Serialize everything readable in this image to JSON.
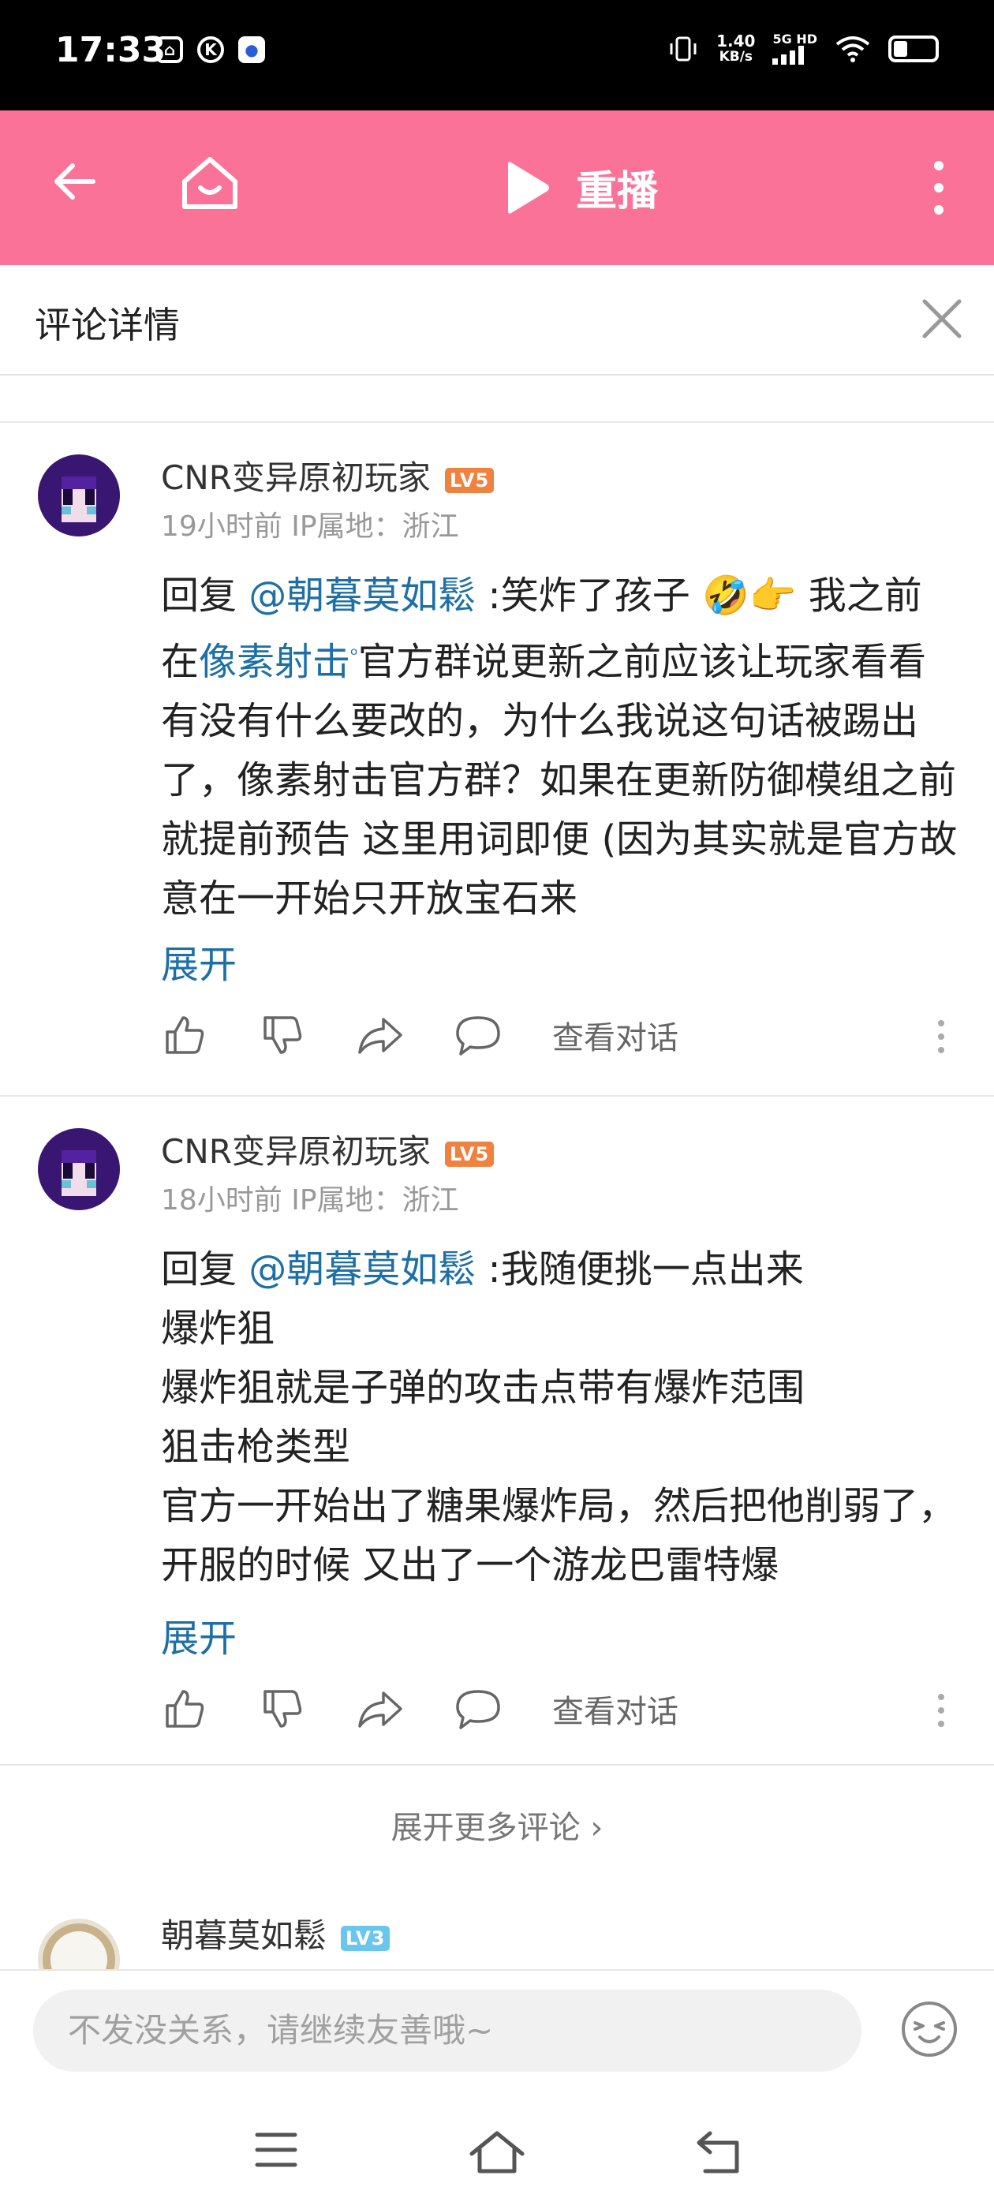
{
  "status_bar": {
    "time": "17:33",
    "left_icons": [
      "tv-icon",
      "k-icon",
      "paw-app-icon"
    ],
    "speed_value": "1.40",
    "speed_unit": "KB/s",
    "network": "5G HD"
  },
  "header": {
    "replay_label": "重播",
    "accent_color": "#fb7299"
  },
  "panel": {
    "title": "评论详情"
  },
  "comments": [
    {
      "username": "CNR变异原初玩家",
      "level": "LV5",
      "meta": "19小时前 IP属地：浙江",
      "reply_prefix": "回复 ",
      "mention": "@朝暮莫如鬆",
      "text_a": " :笑炸了孩子 🤣👉 我之前在",
      "link": "像素射击",
      "text_b": "官方群说更新之前应该让玩家看看有没有什么要改的，为什么我说这句话被踢出了，像素射击官方群？如果在更新防御模组之前就提前预告 这里用词即便 (因为其实就是官方故意在一开始只开放宝石来",
      "expand": "展开",
      "view_conversation": "查看对话"
    },
    {
      "username": "CNR变异原初玩家",
      "level": "LV5",
      "meta": "18小时前 IP属地：浙江",
      "reply_prefix": "回复 ",
      "mention": "@朝暮莫如鬆",
      "line1": " :我随便挑一点出来",
      "line2": "爆炸狙",
      "line3": "爆炸狙就是子弹的攻击点带有爆炸范围",
      "line4": "狙击枪类型",
      "line5": "官方一开始出了糖果爆炸局，然后把他削弱了，开服的时候 又出了一个游龙巴雷特爆",
      "expand": "展开",
      "view_conversation": "查看对话"
    }
  ],
  "expand_more": "展开更多评论 ›",
  "next_comment": {
    "username": "朝暮莫如鬆",
    "level": "LV3"
  },
  "input": {
    "placeholder": "不发没关系，请继续友善哦~"
  }
}
